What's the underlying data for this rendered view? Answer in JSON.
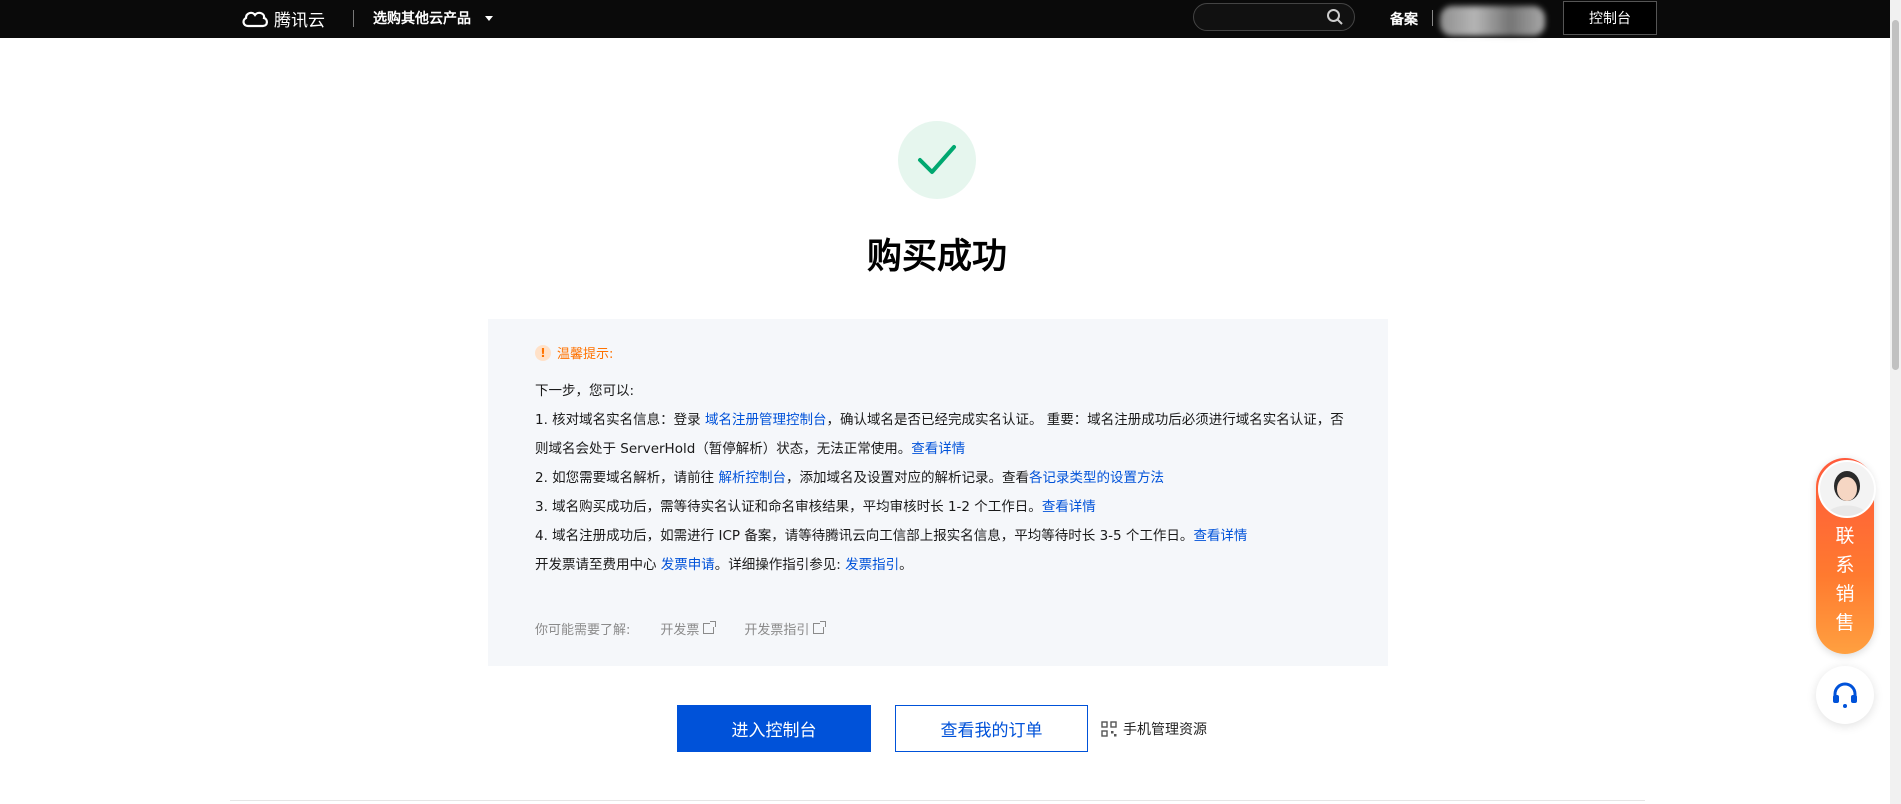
{
  "topbar": {
    "logo_text": "腾讯云",
    "products_label": "选购其他云产品",
    "search_placeholder": "",
    "beian_label": "备案",
    "console_label": "控制台"
  },
  "success": {
    "title": "购买成功"
  },
  "tip": {
    "heading": "温馨提示:",
    "intro": "下一步，您可以:",
    "item1_a": "1. 核对域名实名信息：登录 ",
    "item1_link": "域名注册管理控制台",
    "item1_b": "，确认域名是否已经完成实名认证。 重要：域名注册成功后必须进行域名实名认证，否则域名会处于 ServerHold（暂停解析）状态，无法正常使用。",
    "item1_more": "查看详情",
    "item2_a": "2. 如您需要域名解析，请前往 ",
    "item2_link": "解析控制台",
    "item2_b": "，添加域名及设置对应的解析记录。查看",
    "item2_link2": "各记录类型的设置方法",
    "item3_a": "3. 域名购买成功后，需等待实名认证和命名审核结果，平均审核时长 1-2 个工作日。",
    "item3_more": "查看详情",
    "item4_a": "4. 域名注册成功后，如需进行 ICP 备案，请等待腾讯云向工信部上报实名信息，平均等待时长 3-5 个工作日。",
    "item4_more": "查看详情",
    "invoice_a": "开发票请至费用中心 ",
    "invoice_link": "发票申请",
    "invoice_b": "。详细操作指引参见: ",
    "invoice_link2": "发票指引",
    "invoice_c": "。",
    "hint_label": "你可能需要了解:",
    "hint_link1": "开发票",
    "hint_link2": "开发票指引"
  },
  "actions": {
    "primary": "进入控制台",
    "secondary": "查看我的订单",
    "mobile": "手机管理资源"
  },
  "float": {
    "sales_text": "联系销售"
  },
  "colors": {
    "brand_blue": "#0052d9",
    "success_green": "#00a870",
    "warning_orange": "#ff7200"
  }
}
